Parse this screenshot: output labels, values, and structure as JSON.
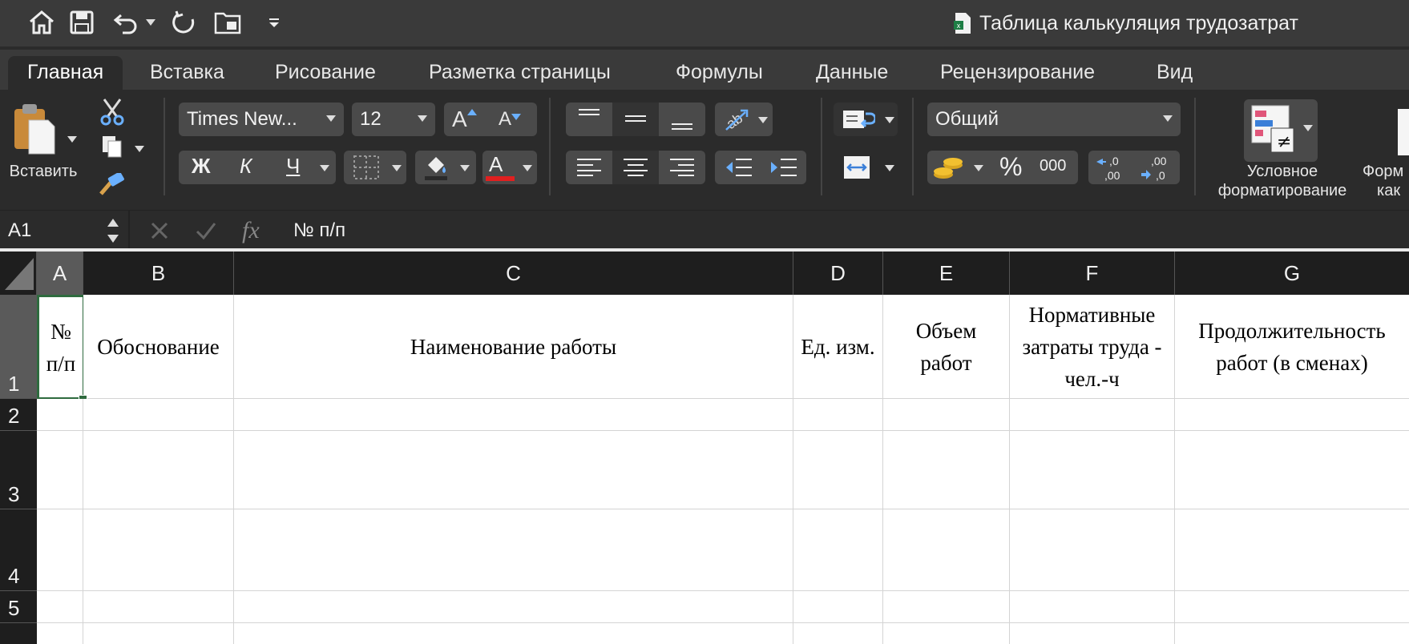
{
  "window": {
    "title": "Таблица калькуляция трудозатрат"
  },
  "tabs": [
    "Главная",
    "Вставка",
    "Рисование",
    "Разметка страницы",
    "Формулы",
    "Данные",
    "Рецензирование",
    "Вид"
  ],
  "ribbon": {
    "paste_label": "Вставить",
    "font_name": "Times New...",
    "font_size": "12",
    "bold": "Ж",
    "italic": "К",
    "underline": "Ч",
    "grow_font": "A",
    "shrink_font": "A",
    "font_color_letter": "A",
    "number_format": "Общий",
    "percent": "%",
    "thousands": "000",
    "inc_decimal": ",0\n,00",
    "dec_decimal": ",00\n,0",
    "cond_format_line1": "Условное",
    "cond_format_line2": "форматирование",
    "format_table_line1": "Форм",
    "format_table_line2": "как",
    "colors": {
      "font_color_bar": "#e02020",
      "accent": "#2f6b3f"
    }
  },
  "formula_bar": {
    "name_box": "A1",
    "fx": "fx",
    "formula": "№ п/п"
  },
  "columns": [
    "A",
    "B",
    "C",
    "D",
    "E",
    "F",
    "G"
  ],
  "rows": [
    "1",
    "2",
    "3",
    "4",
    "5"
  ],
  "header_row": {
    "A": "№ п/п",
    "B": "Обоснование",
    "C": "Наименование работы",
    "D": "Ед. изм.",
    "E": "Объем работ",
    "F": "Нормативные затраты труда - чел.-ч",
    "G": "Продолжительность работ (в сменах)"
  }
}
